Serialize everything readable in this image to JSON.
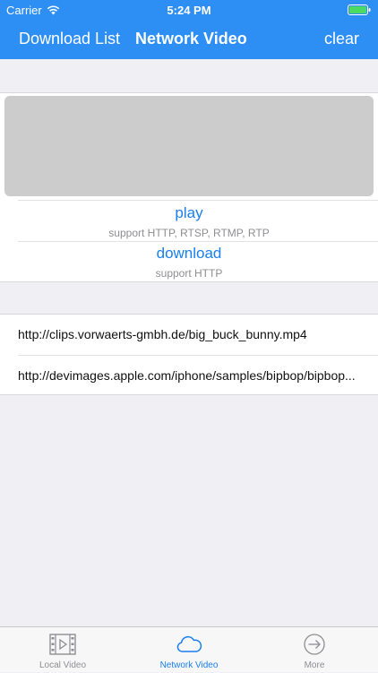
{
  "status": {
    "carrier": "Carrier",
    "time": "5:24 PM"
  },
  "nav": {
    "left_label": "Download List",
    "title": "Network Video",
    "right_label": "clear"
  },
  "actions": [
    {
      "title": "play",
      "subtitle": "support HTTP, RTSP, RTMP, RTP"
    },
    {
      "title": "download",
      "subtitle": "support HTTP"
    }
  ],
  "urls": [
    "http://clips.vorwaerts-gmbh.de/big_buck_bunny.mp4",
    "http://devimages.apple.com/iphone/samples/bipbop/bipbop..."
  ],
  "tabs": [
    {
      "label": "Local Video",
      "icon": "film-icon",
      "selected": false
    },
    {
      "label": "Network Video",
      "icon": "cloud-icon",
      "selected": true
    },
    {
      "label": "More",
      "icon": "arrow-circle-icon",
      "selected": false
    }
  ],
  "colors": {
    "accent": "#2d8ef4",
    "link": "#1a7ff0",
    "tab_inactive": "#8e8e93",
    "background": "#efeff4"
  }
}
